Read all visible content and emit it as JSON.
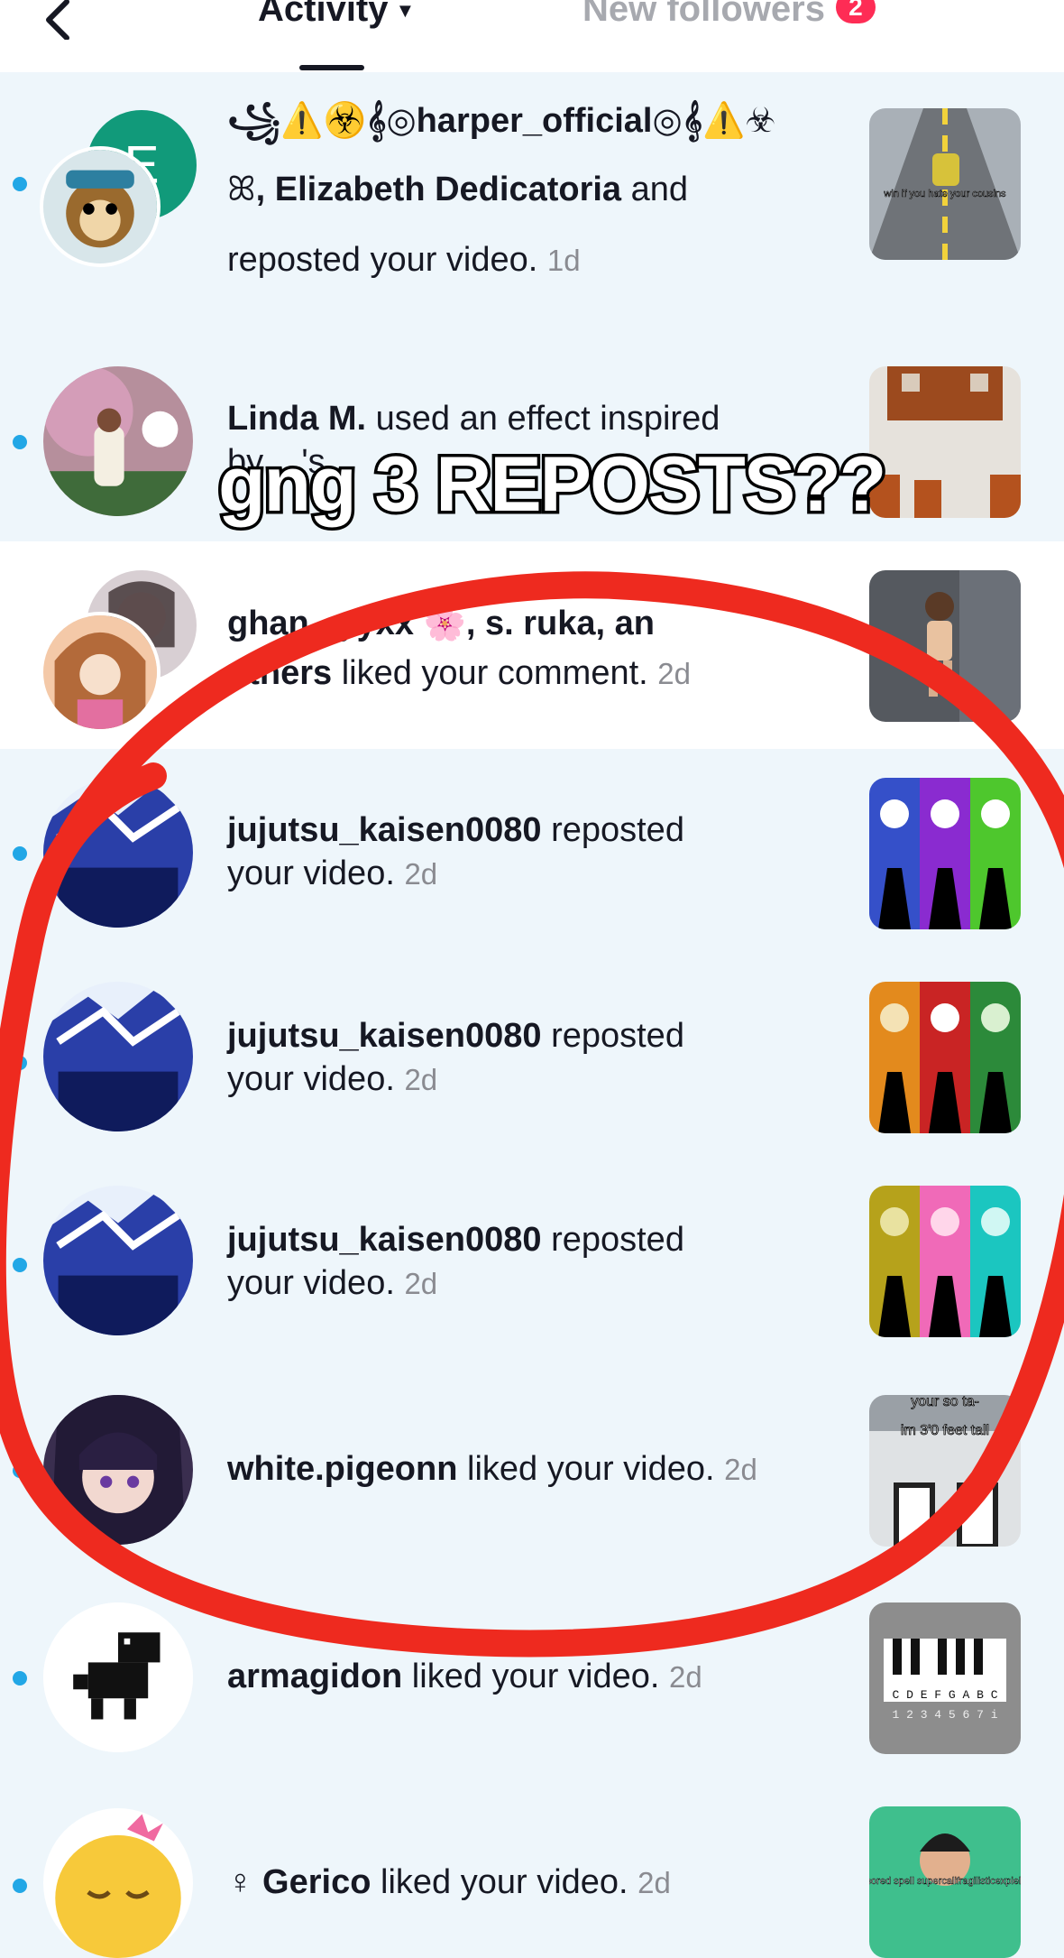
{
  "header": {
    "tab_activity": "Activity",
    "tab_followers": "New followers",
    "followers_badge": "2"
  },
  "overlay_caption": "gng 3 REPOSTS??",
  "notifications": [
    {
      "user": "꧁⚠️☣️𝄞◎harper_official◎𝄞⚠️☣",
      "line2_user": ", Elizabeth Dedicatoria",
      "line2_rest": " and",
      "line3": "reposted your video.",
      "time": "1d",
      "thumb_caption": "win if you hate your cousins"
    },
    {
      "user": "Linda M.",
      "text": " used an effect inspired",
      "line2": "by ...'s",
      "time": ""
    },
    {
      "user": "ghan...yyxx 🌸, s. ruka, an",
      "line2_user": "others",
      "line2_rest": " liked your comment.",
      "time": "2d"
    },
    {
      "user": "jujutsu_kaisen0080",
      "text": " reposted",
      "line2": "your video.",
      "time": "2d"
    },
    {
      "user": "jujutsu_kaisen0080",
      "text": " reposted",
      "line2": "your video.",
      "time": "2d"
    },
    {
      "user": "jujutsu_kaisen0080",
      "text": " reposted",
      "line2": "your video.",
      "time": "2d"
    },
    {
      "user": "white.pigeonn",
      "text": " liked your video.",
      "time": "2d",
      "thumb_caption_top": "your so ta-",
      "thumb_caption": "im 3'0 feet tall"
    },
    {
      "user": "armagidon",
      "text": " liked your video.",
      "time": "2d",
      "piano_keys": "C D E F G A B C",
      "piano_nums": "1 2 3 4 5 6 7 i"
    },
    {
      "user": "♀ Gerico",
      "text": " liked your video.",
      "time": "2d",
      "thumb_caption": "im bored spell supercalifragilisticexpieledo"
    }
  ],
  "colors": {
    "accent": "#fe2c55",
    "unread_dot": "#22a7e6",
    "annotation_red": "#ee2a1f"
  }
}
